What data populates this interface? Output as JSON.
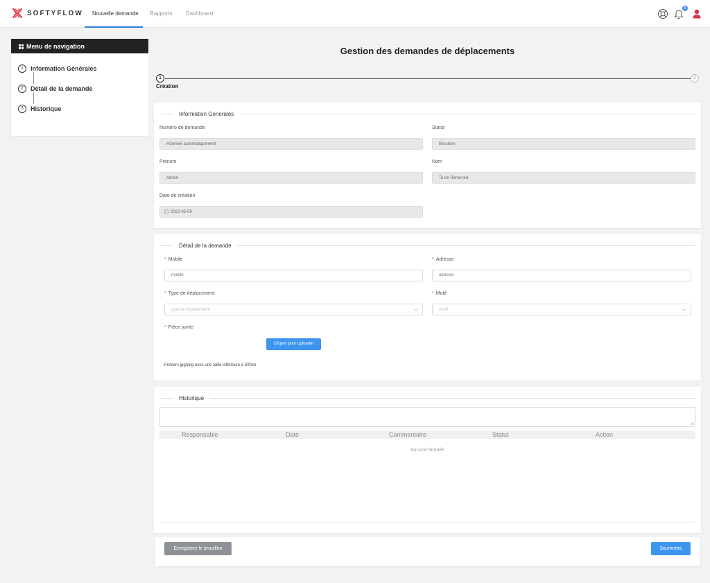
{
  "header": {
    "brand": "SOFTYFLOW",
    "brand_color": "#e4414a",
    "accent_color": "#2f7fd9",
    "nav": [
      {
        "label": "Nouvelle demande",
        "active": true
      },
      {
        "label": "Rapports",
        "active": false
      },
      {
        "label": "Dashboard",
        "active": false
      }
    ],
    "notifications_count": "5",
    "icons": [
      "help-lifebuoy-icon",
      "bell-icon",
      "user-icon"
    ]
  },
  "sidebar": {
    "title": "Menu de navigation",
    "items": [
      {
        "num": "1",
        "label": "Information Générales"
      },
      {
        "num": "2",
        "label": "Détail de la demande"
      },
      {
        "num": "3",
        "label": "Historique"
      }
    ]
  },
  "page": {
    "title": "Gestion des demandes de déplacements",
    "steps": [
      {
        "num": "1",
        "label": "Création",
        "active": true
      },
      {
        "num": "2",
        "label": "",
        "active": false
      }
    ]
  },
  "info": {
    "title": "Information Generales",
    "numero_label": "Numéro de demande",
    "numero_value": "#Généré automatiquement",
    "statut_label": "Statut",
    "statut_value": "Brouillon",
    "prenom_label": "Prénom",
    "prenom_value": "Admin",
    "nom_label": "Nom",
    "nom_value": "To be Removed",
    "date_label": "Date de création",
    "date_value": "2022-05-09"
  },
  "detail": {
    "title": "Détail de la demande",
    "required_mark": "*",
    "mobile_label": "Mobile",
    "mobile_placeholder": "mobile",
    "adresse_label": "Adresse",
    "adresse_placeholder": "adresse",
    "type_label": "Type de déplacement",
    "type_placeholder": "type de déplacement",
    "motif_label": "Motif",
    "motif_placeholder": "motif",
    "piece_label": "Pièce jointe",
    "upload_button": "Cliquer pour uploader",
    "upload_hint": "Fichiers jpg/png avec une taille inférieure à 500kb"
  },
  "historique": {
    "title": "Historique",
    "columns": [
      "Responsable",
      "Date",
      "Commentaire",
      "Statut",
      "Action"
    ],
    "empty_text": "Aucune donnée"
  },
  "footer": {
    "draft_button": "Enregistrer le brouillon",
    "submit_button": "Soumettre"
  }
}
